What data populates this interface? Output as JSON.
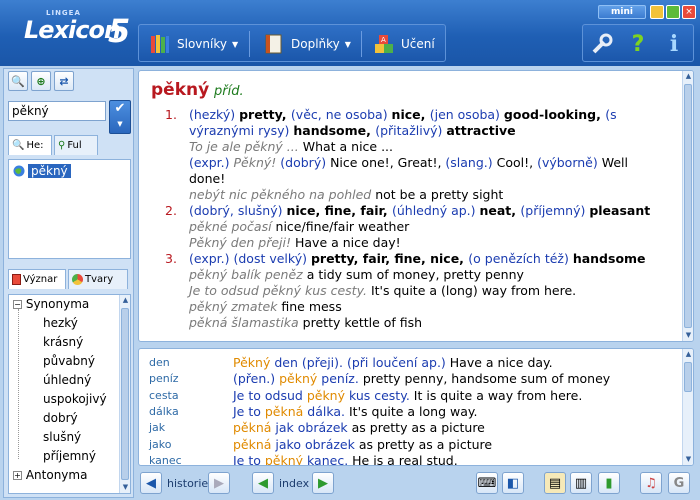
{
  "app": {
    "brand": "LINGEA",
    "name": "Lexicon",
    "version": "5",
    "mini_label": "mini"
  },
  "menu": [
    {
      "label": "Slovníky",
      "icon": "books-icon",
      "dropdown": true
    },
    {
      "label": "Doplňky",
      "icon": "book-icon",
      "dropdown": true
    },
    {
      "label": "Učení",
      "icon": "abc-blocks-icon",
      "dropdown": false
    }
  ],
  "tools": [
    {
      "name": "settings-wrench-icon",
      "glyph": "🔧"
    },
    {
      "name": "help-icon",
      "glyph": "?"
    },
    {
      "name": "info-icon",
      "glyph": "i"
    }
  ],
  "left": {
    "search_value": "pěkný",
    "tabs_top": [
      {
        "label": "He:",
        "icon": "search-icon"
      },
      {
        "label": "Ful",
        "icon": "binoculars-icon"
      }
    ],
    "result": "pěkný",
    "tabs_bottom": [
      {
        "label": "Význar",
        "icon": "meaning-icon"
      },
      {
        "label": "Tvary",
        "icon": "forms-icon"
      }
    ],
    "tree": [
      {
        "label": "Synonyma",
        "level": 0,
        "expander": "-"
      },
      {
        "label": "hezký",
        "level": 1
      },
      {
        "label": "krásný",
        "level": 1
      },
      {
        "label": "půvabný",
        "level": 1
      },
      {
        "label": "úhledný",
        "level": 1
      },
      {
        "label": "uspokojivý",
        "level": 1
      },
      {
        "label": "dobrý",
        "level": 1
      },
      {
        "label": "slušný",
        "level": 1
      },
      {
        "label": "příjemný",
        "level": 1
      },
      {
        "label": "Antonyma",
        "level": 0,
        "expander": "+"
      }
    ]
  },
  "entry": {
    "headword": "pěkný",
    "pos": "příd.",
    "senses": [
      {
        "number": "1.",
        "lines": [
          [
            [
              "lbl",
              "(hezký) "
            ],
            [
              "en",
              "pretty, "
            ],
            [
              "lbl",
              "(věc, ne osoba) "
            ],
            [
              "en",
              "nice, "
            ],
            [
              "lbl",
              "(jen osoba) "
            ],
            [
              "en",
              "good-looking, "
            ],
            [
              "lbl",
              "(s"
            ]
          ],
          [
            [
              "lbl",
              "výraznými rysy) "
            ],
            [
              "en",
              "handsome, "
            ],
            [
              "lbl",
              "(přitažlivý) "
            ],
            [
              "en",
              "attractive"
            ]
          ],
          [
            [
              "ex",
              "To je ale pěkný ... "
            ],
            [
              "tr",
              " What a nice ..."
            ]
          ],
          [
            [
              "lbl",
              "(expr.) "
            ],
            [
              "ex",
              "Pěkný! "
            ],
            [
              "lbl",
              "(dobrý) "
            ],
            [
              "tr",
              " Nice one!, Great!, "
            ],
            [
              "lbl",
              "(slang.) "
            ],
            [
              "tr",
              "Cool!, "
            ],
            [
              "lbl",
              "(výborně) "
            ],
            [
              "tr",
              "Well"
            ]
          ],
          [
            [
              "tr",
              "done!"
            ]
          ],
          [
            [
              "ex",
              "nebýt nic pěkného na pohled "
            ],
            [
              "tr",
              " not be a pretty sight"
            ]
          ]
        ]
      },
      {
        "number": "2.",
        "lines": [
          [
            [
              "lbl",
              "(dobrý, slušný) "
            ],
            [
              "en",
              "nice, fine, fair, "
            ],
            [
              "lbl",
              "(úhledný ap.) "
            ],
            [
              "en",
              "neat, "
            ],
            [
              "lbl",
              "(příjemný) "
            ],
            [
              "en",
              "pleasant"
            ]
          ],
          [
            [
              "ex",
              "pěkné počasí "
            ],
            [
              "tr",
              " nice/fine/fair weather"
            ]
          ],
          [
            [
              "ex",
              "Pěkný den přeji! "
            ],
            [
              "tr",
              " Have a nice day!"
            ]
          ]
        ]
      },
      {
        "number": "3.",
        "lines": [
          [
            [
              "lbl",
              "(expr.) "
            ],
            [
              "lbl",
              "(dost velký) "
            ],
            [
              "en",
              "pretty, fair, fine, nice, "
            ],
            [
              "lbl",
              "(o penězích též) "
            ],
            [
              "en",
              "handsome"
            ]
          ],
          [
            [
              "ex",
              "pěkný balík peněz "
            ],
            [
              "tr",
              " a tidy sum of money, pretty penny"
            ]
          ],
          [
            [
              "ex",
              "Je to odsud pěkný kus cesty. "
            ],
            [
              "tr",
              " It's quite a (long) way from here."
            ]
          ],
          [
            [
              "ex",
              "pěkný zmatek "
            ],
            [
              "tr",
              " fine mess"
            ]
          ],
          [
            [
              "ex",
              "pěkná šlamastika "
            ],
            [
              "tr",
              " pretty kettle of fish"
            ]
          ]
        ]
      }
    ]
  },
  "phrases": [
    {
      "key": "den",
      "parts": [
        [
          "hl",
          "Pěkný"
        ],
        [
          "cz",
          " den (přeji). "
        ],
        [
          "lbl",
          "(při loučení ap.) "
        ],
        [
          "tr",
          " Have a nice day."
        ]
      ]
    },
    {
      "key": "peníz",
      "parts": [
        [
          "lbl",
          "(přen.) "
        ],
        [
          "hl",
          "pěkný"
        ],
        [
          "cz",
          " peníz. "
        ],
        [
          "tr",
          " pretty penny, handsome sum of money"
        ]
      ]
    },
    {
      "key": "cesta",
      "parts": [
        [
          "cz",
          "Je to odsud "
        ],
        [
          "hl",
          "pěkný"
        ],
        [
          "cz",
          " kus cesty. "
        ],
        [
          "tr",
          " It is quite a way from here."
        ]
      ]
    },
    {
      "key": "dálka",
      "parts": [
        [
          "cz",
          "Je to "
        ],
        [
          "hl",
          "pěkná"
        ],
        [
          "cz",
          " dálka. "
        ],
        [
          "tr",
          " It's quite a long way."
        ]
      ]
    },
    {
      "key": "jak",
      "parts": [
        [
          "hl",
          "pěkná"
        ],
        [
          "cz",
          " jak obrázek "
        ],
        [
          "tr",
          " as pretty as a picture"
        ]
      ]
    },
    {
      "key": "jako",
      "parts": [
        [
          "hl",
          "pěkná"
        ],
        [
          "cz",
          " jako obrázek "
        ],
        [
          "tr",
          " as pretty as a picture"
        ]
      ]
    },
    {
      "key": "kanec",
      "parts": [
        [
          "cz",
          "Je to "
        ],
        [
          "hl",
          "pěkný"
        ],
        [
          "cz",
          " kanec. "
        ],
        [
          "tr",
          " He is a real stud."
        ]
      ]
    }
  ],
  "bottom": {
    "history_label": "historie",
    "index_label": "index"
  }
}
